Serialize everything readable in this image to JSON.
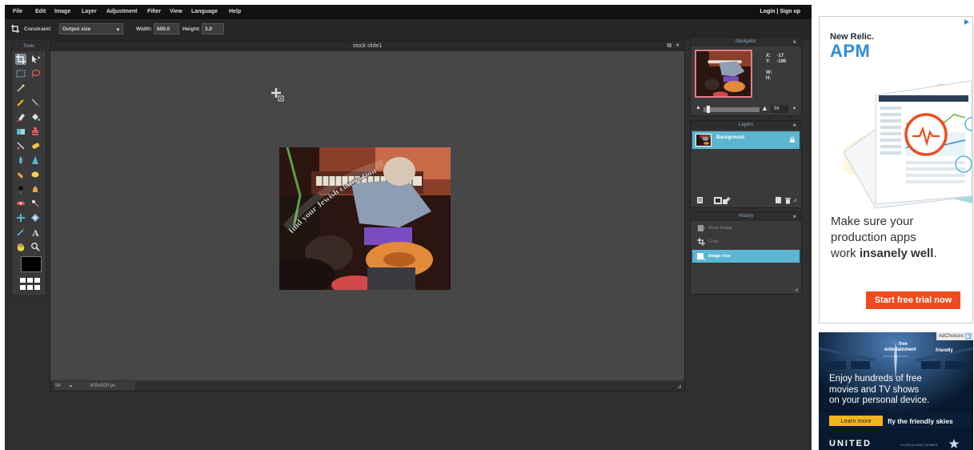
{
  "menubar": {
    "items": [
      "File",
      "Edit",
      "Image",
      "Layer",
      "Adjustment",
      "Filter",
      "View",
      "Language",
      "Help"
    ],
    "auth": "Login | Sign up"
  },
  "toolbar": {
    "constraint_label": "Constraint:",
    "constraint_value": "Output size",
    "width_label": "Width:",
    "width_value": "600.0",
    "height_label": "Height:",
    "height_value": "3.0"
  },
  "tools": {
    "title": "Tools"
  },
  "canvas": {
    "title": "stock slide1",
    "zoom": "56",
    "size": "600x500 px"
  },
  "navigator": {
    "title": "Navigator",
    "x_label": "X:",
    "x_value": "-17",
    "y_label": "Y:",
    "y_value": "-186",
    "w_label": "W:",
    "h_label": "H:",
    "zoom": "56"
  },
  "layers": {
    "title": "Layers",
    "items": [
      {
        "name": "Background"
      }
    ]
  },
  "history": {
    "title": "History",
    "items": [
      {
        "label": "Open image",
        "selected": false
      },
      {
        "label": "Crop",
        "selected": false
      },
      {
        "label": "Image size",
        "selected": true
      }
    ]
  },
  "ad_newrelic": {
    "brand": "New Relic.",
    "product": "APM",
    "copy_1": "Make sure your",
    "copy_2": "production apps",
    "copy_3a": "work ",
    "copy_3b": "insanely well",
    "copy_3c": ".",
    "cta": "Start free trial now",
    "brand_color": "#2b8ed6",
    "cta_color": "#ee4c1e"
  },
  "ad_united": {
    "adchoices": "AdChoices",
    "free": "free",
    "entertainment": "entertainment",
    "friendly": "friendly",
    "headline_1": "Enjoy hundreds of free",
    "headline_2": "movies and TV shows",
    "headline_3": "on your personal device.",
    "learn_more": "Learn more",
    "tagline": "fly the friendly skies",
    "logo": "UNITED",
    "alliance": "A STAR ALLIANCE MEMBER",
    "accent": "#f2b41c"
  },
  "colors": {
    "selection": "#5cb6d1",
    "app_bg": "#2f2f2f",
    "canvas_bg": "#474747"
  }
}
